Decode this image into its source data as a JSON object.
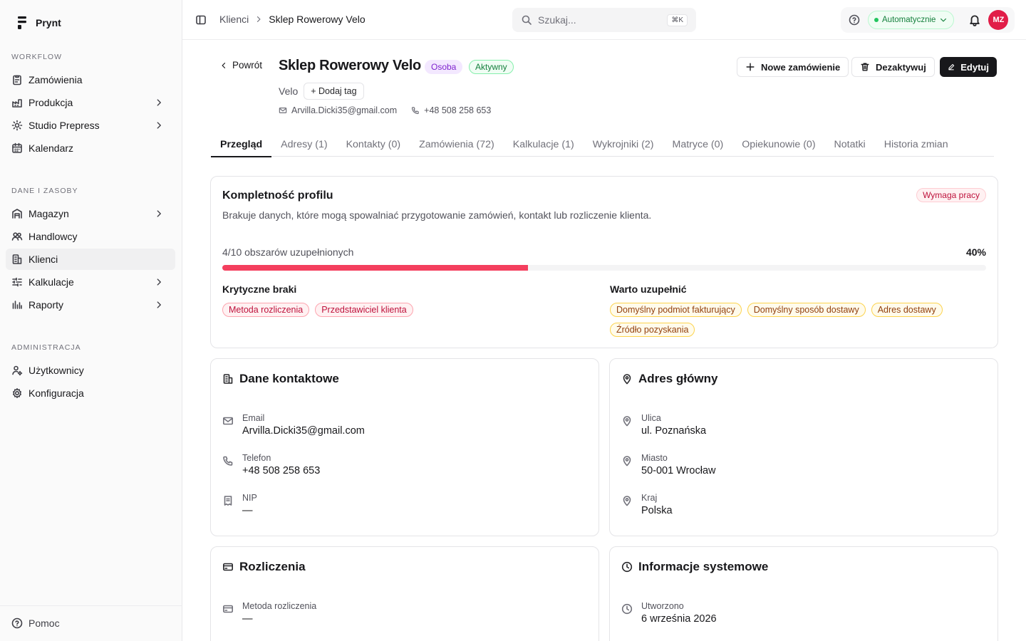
{
  "brand": {
    "name": "Prynt"
  },
  "sidebar": {
    "sections": [
      {
        "title": "WORKFLOW"
      },
      {
        "title": "DANE I ZASOBY"
      },
      {
        "title": "ADMINISTRACJA"
      }
    ],
    "items": [
      {
        "label": "Zamówienia",
        "icon": "clipboard-icon",
        "chevron": false
      },
      {
        "label": "Produkcja",
        "icon": "factory-icon",
        "chevron": true
      },
      {
        "label": "Studio Prepress",
        "icon": "sun-icon",
        "chevron": true
      },
      {
        "label": "Kalendarz",
        "icon": "calendar-icon",
        "chevron": false
      },
      {
        "label": "Magazyn",
        "icon": "warehouse-icon",
        "chevron": true
      },
      {
        "label": "Handlowcy",
        "icon": "users-icon",
        "chevron": false
      },
      {
        "label": "Klienci",
        "icon": "building-icon",
        "chevron": false,
        "active": true
      },
      {
        "label": "Kalkulacje",
        "icon": "sliders-icon",
        "chevron": true
      },
      {
        "label": "Raporty",
        "icon": "chart-icon",
        "chevron": true
      },
      {
        "label": "Użytkownicy",
        "icon": "user-cog-icon",
        "chevron": false
      },
      {
        "label": "Konfiguracja",
        "icon": "gear-icon",
        "chevron": false
      }
    ],
    "help_label": "Pomoc"
  },
  "topbar": {
    "breadcrumb": [
      "Klienci",
      "Sklep Rowerowy Velo"
    ],
    "search_placeholder": "Szukaj...",
    "search_shortcut": "⌘K",
    "mode_label": "Automatycznie",
    "avatar_initials": "MZ"
  },
  "client": {
    "back_label": "Powrót",
    "name": "Sklep Rowerowy Velo",
    "type_badge": "Osoba",
    "status_badge": "Aktywny",
    "short_name": "Velo",
    "add_tag_label": "+ Dodaj tag",
    "email": "Arvilla.Dicki35@gmail.com",
    "phone": "+48 508 258 653",
    "actions": {
      "new_order": "Nowe zamówienie",
      "deactivate": "Dezaktywuj",
      "edit": "Edytuj"
    }
  },
  "tabs": [
    {
      "label": "Przegląd",
      "active": true
    },
    {
      "label": "Adresy (1)"
    },
    {
      "label": "Kontakty (0)"
    },
    {
      "label": "Zamówienia (72)"
    },
    {
      "label": "Kalkulacje (1)"
    },
    {
      "label": "Wykrojniki (2)"
    },
    {
      "label": "Matryce (0)"
    },
    {
      "label": "Opiekunowie (0)"
    },
    {
      "label": "Notatki"
    },
    {
      "label": "Historia zmian"
    }
  ],
  "completeness": {
    "title": "Kompletność profilu",
    "badge": "Wymaga pracy",
    "description": "Brakuje danych, które mogą spowalniać przygotowanie zamówień, kontakt lub rozliczenie klienta.",
    "progress_label": "4/10 obszarów uzupełnionych",
    "progress_pct_label": "40%",
    "progress_value": 0.4,
    "critical_title": "Krytyczne braki",
    "critical": [
      "Metoda rozliczenia",
      "Przedstawiciel klienta"
    ],
    "recommended_title": "Warto uzupełnić",
    "recommended": [
      "Domyślny podmiot fakturujący",
      "Domyślny sposób dostawy",
      "Adres dostawy",
      "Źródło pozyskania"
    ]
  },
  "contact_card": {
    "title": "Dane kontaktowe",
    "fields": [
      {
        "label": "Email",
        "value": "Arvilla.Dicki35@gmail.com"
      },
      {
        "label": "Telefon",
        "value": "+48 508 258 653"
      },
      {
        "label": "NIP",
        "value": "—"
      }
    ]
  },
  "address_card": {
    "title": "Adres główny",
    "fields": [
      {
        "label": "Ulica",
        "value": "ul. Poznańska"
      },
      {
        "label": "Miasto",
        "value": "50-001 Wrocław"
      },
      {
        "label": "Kraj",
        "value": "Polska"
      }
    ]
  },
  "billing_card": {
    "title": "Rozliczenia",
    "fields": [
      {
        "label": "Metoda rozliczenia",
        "value": "—"
      }
    ]
  },
  "system_card": {
    "title": "Informacje systemowe",
    "fields": [
      {
        "label": "Utworzono",
        "value": "6 września 2026"
      }
    ]
  }
}
